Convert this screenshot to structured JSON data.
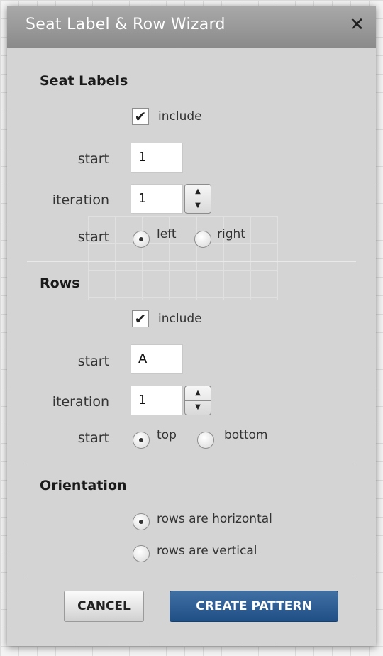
{
  "dialog": {
    "title": "Seat Label & Row Wizard",
    "close_glyph": "✕"
  },
  "seat_labels": {
    "heading": "Seat Labels",
    "include_label": "include",
    "include_checked": true,
    "start_label": "start",
    "start_value": "1",
    "iteration_label": "iteration",
    "iteration_value": "1",
    "direction_label": "start",
    "direction_options": [
      {
        "label": "left",
        "selected": true
      },
      {
        "label": "right",
        "selected": false
      }
    ]
  },
  "rows": {
    "heading": "Rows",
    "include_label": "include",
    "include_checked": true,
    "start_label": "start",
    "start_value": "A",
    "iteration_label": "iteration",
    "iteration_value": "1",
    "direction_label": "start",
    "direction_options": [
      {
        "label": "top",
        "selected": true
      },
      {
        "label": "bottom",
        "selected": false
      }
    ]
  },
  "orientation": {
    "heading": "Orientation",
    "options": [
      {
        "label": "rows are horizontal",
        "selected": true
      },
      {
        "label": "rows are vertical",
        "selected": false
      }
    ]
  },
  "buttons": {
    "cancel": "CANCEL",
    "create": "CREATE PATTERN"
  },
  "glyphs": {
    "check": "✔",
    "up": "▲",
    "down": "▼"
  }
}
